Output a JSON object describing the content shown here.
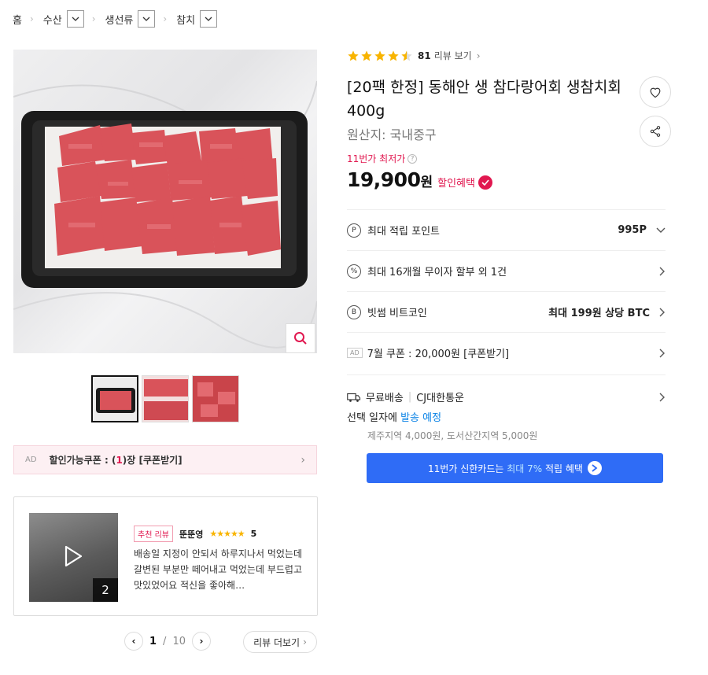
{
  "breadcrumb": [
    "홈",
    "수산",
    "생선류",
    "참치"
  ],
  "rating": {
    "stars": 4.5,
    "count": "81",
    "label": "리뷰 보기"
  },
  "product": {
    "title": "[20팩 한정] 동해안 생 참다랑어회 생참치회 400g",
    "origin_label": "원산지:",
    "origin_value": "국내중구",
    "lowest_label": "11번가 최저가",
    "price": "19,900",
    "won": "원",
    "discount_label": "할인혜택"
  },
  "info_rows": [
    {
      "icon": "P",
      "label": "최대 적립 포인트",
      "value": "995P"
    },
    {
      "icon": "%",
      "label": "최대 16개월 무이자 할부 외 1건",
      "value": ""
    },
    {
      "icon": "B",
      "label": "빗썸 비트코인",
      "value": "최대 199원 상당 BTC"
    },
    {
      "ad": "AD",
      "label": "7월 쿠폰 : 20,000원 [쿠폰받기]",
      "value": ""
    }
  ],
  "shipping": {
    "free": "무료배송",
    "courier": "CJ대한통운",
    "schedule_prefix": "선택 일자에 ",
    "schedule_blue": "발송 예정",
    "extra": "제주지역 4,000원, 도서산간지역 5,000원"
  },
  "card_banner": {
    "prefix": "11번가 신한카드는 ",
    "highlight": "최대 7%",
    "suffix": " 적립 혜택"
  },
  "coupon_banner": {
    "ad": "AD",
    "text_prefix": "할인가능쿠폰 : (",
    "count": "1",
    "text_suffix": ")장 [쿠폰받기]"
  },
  "review": {
    "badge": "추천 리뷰",
    "reviewer": "뚠뚠영",
    "stars": "★★★★★",
    "score": "5",
    "text": "배송일 지정이 안되서 하루지나서 먹었는데 갈변된 부분만 떼어내고 먹었는데 부드럽고 맛있었어요 적신을 좋아해…",
    "video_count": "2"
  },
  "pager": {
    "current": "1",
    "sep": "/",
    "total": "10",
    "more": "리뷰 더보기"
  },
  "colors": {
    "accent": "#e1174f",
    "blue": "#2f6cf6",
    "star": "#f8b400"
  }
}
